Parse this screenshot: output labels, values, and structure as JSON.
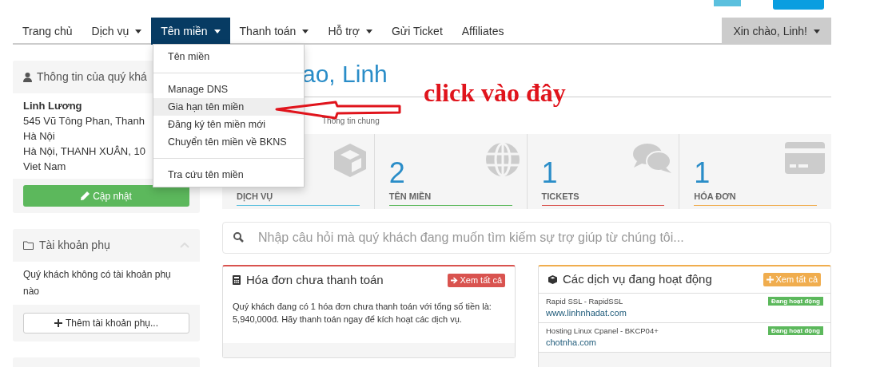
{
  "nav": {
    "items": [
      {
        "label": "Trang chủ",
        "caret": false,
        "selected": false
      },
      {
        "label": "Dịch vụ",
        "caret": true,
        "selected": false
      },
      {
        "label": "Tên miền",
        "caret": true,
        "selected": true
      },
      {
        "label": "Thanh toán",
        "caret": true,
        "selected": false
      },
      {
        "label": "Hỗ trợ",
        "caret": true,
        "selected": false
      },
      {
        "label": "Gửi Ticket",
        "caret": false,
        "selected": false
      },
      {
        "label": "Affiliates",
        "caret": false,
        "selected": false
      }
    ],
    "user_menu": "Xin chào, Linh!"
  },
  "dropdown": [
    {
      "kind": "item",
      "label": "Tên miền",
      "selected": false
    },
    {
      "kind": "divider"
    },
    {
      "kind": "item",
      "label": "Manage DNS",
      "selected": false
    },
    {
      "kind": "item",
      "label": "Gia hạn tên miền",
      "selected": true
    },
    {
      "kind": "item",
      "label": "Đăng ký tên miền mới",
      "selected": false
    },
    {
      "kind": "item",
      "label": "Chuyển tên miền về BKNS",
      "selected": false
    },
    {
      "kind": "divider"
    },
    {
      "kind": "item",
      "label": "Tra cứu tên miền",
      "selected": false
    }
  ],
  "customer_card": {
    "title": "Thông tin của quý khá",
    "name": "Linh Lương",
    "lines": [
      "545 Vũ Tông Phan, Thanh",
      "Hà Nội",
      "Hà Nội, THANH XUÂN, 10",
      "Viet Nam"
    ],
    "button": "Cập nhật"
  },
  "sub_accounts": {
    "title": "Tài khoản phụ",
    "text": "Quý khách không có tài khoản phụ nào",
    "button": "Thêm tài khoản phụ..."
  },
  "heading": "ao, Linh",
  "breadcrumb": "Thông tin chung",
  "annotation": "click vào đây",
  "stats": [
    {
      "kind": "box",
      "label": "DỊCH VỤ",
      "color": "#5bc0de"
    },
    {
      "kind": "globe",
      "value": "2",
      "label": "TÊN MIỀN",
      "color": "#5cb85c"
    },
    {
      "kind": "chat",
      "value": "1",
      "label": "TICKETS",
      "color": "#d9534f"
    },
    {
      "kind": "card",
      "value": "1",
      "label": "HÓA ĐƠN",
      "color": "#f0ad4e"
    }
  ],
  "search": {
    "placeholder": "Nhập câu hỏi mà quý khách đang muốn tìm kiếm sự trợ giúp từ chúng tôi..."
  },
  "invoices_panel": {
    "title": "Hóa đơn chưa thanh toán",
    "button": "Xem tất cả",
    "text": "Quý khách đang có 1 hóa đơn chưa thanh toán với tổng số tiền là: 5,940,000đ. Hãy thanh toán ngay để kích hoạt các dịch vụ."
  },
  "services_panel": {
    "title": "Các dịch vụ đang hoạt động",
    "button": "Xem tất cả",
    "rows": [
      {
        "product": "Rapid SSL - RapidSSL",
        "domain": "www.linhnhadat.com",
        "status": "Đang hoạt động"
      },
      {
        "product": "Hosting Linux Cpanel - BKCP04+",
        "domain": "chotnha.com",
        "status": "Đang hoạt động"
      }
    ]
  }
}
